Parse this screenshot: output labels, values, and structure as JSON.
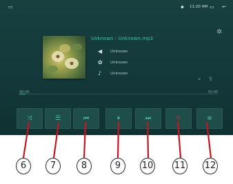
{
  "status_bar": {
    "back_icon": "back-icon",
    "location_icon": "location-icon",
    "time": "11:20 AM",
    "window_icon": "window-icon",
    "return_icon": "return-icon"
  },
  "player": {
    "title": "Unknown - Unknown.mp3",
    "artist": "Unknown",
    "album": "Unknown",
    "file": "Unknown",
    "elapsed": "00:00",
    "duration": "03:45",
    "progress": 0.03,
    "accent_color": "#30c8a8"
  },
  "controls": [
    {
      "icon": "shuffle-icon",
      "glyph": "⤨"
    },
    {
      "icon": "list-icon",
      "glyph": "☰"
    },
    {
      "icon": "previous-icon",
      "glyph": "⏮"
    },
    {
      "icon": "pause-icon",
      "glyph": "⏸"
    },
    {
      "icon": "next-icon",
      "glyph": "⏭"
    },
    {
      "icon": "repeat-icon",
      "glyph": "↻"
    },
    {
      "icon": "eq-icon",
      "glyph": "≡"
    }
  ],
  "callouts": [
    "6",
    "7",
    "8",
    "9",
    "10",
    "11",
    "12"
  ]
}
